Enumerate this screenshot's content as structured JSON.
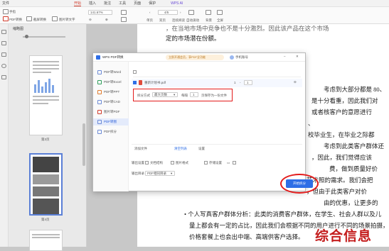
{
  "menubar": {
    "items": [
      "文件",
      "",
      "",
      "",
      "",
      "开始",
      "插入",
      "批注",
      "工具",
      "页面",
      "保护",
      "",
      "WPS AI",
      "",
      ""
    ],
    "active": "开始"
  },
  "toolbar": {
    "left_labels": [
      "手指",
      "PDF转换",
      "截屏转换",
      "图片转文字"
    ],
    "zoom": "141.67%",
    "page": "4/5",
    "view_labels": [
      "单页",
      "双页",
      "连续阅读"
    ],
    "tools": [
      "自动滚动",
      "背景",
      "全屏"
    ]
  },
  "left_panel": {
    "title": "缩略图",
    "thumbs": [
      {
        "label": "第3页"
      },
      {
        "label": "第4页"
      }
    ]
  },
  "document": {
    "lines_top": [
      "，在当地市场中竞争也不是十分激烈。因此该产品在这个市场",
      "定的市场潜在份额。"
    ],
    "lines_right": [
      "考虑到大部分都是 80、",
      "是十分看重，因此我们对",
      "或者核客户的意愿进行",
      "",
      "、",
      "校毕业生，在毕业之际都",
      "考虑到此类客户群体还",
      "，因此，我们觉得应该",
      "费，做到质量好价",
      "艺术照的需求。我们会把",
      "，但由于此类客户对价",
      "由的优惠，让更多的"
    ],
    "bullet": "• 个人写真客户群体分析：此类的消费客户群体，在学生、社会人群以及儿",
    "lines_bottom": [
      "量上都会有一定的占比，因此我们会根据不同的用户进行不同的场景拍摄，",
      "价格套餐上也会出中端、高端供客户选择。"
    ]
  },
  "dialog": {
    "title": "WPS PDF转换",
    "vip_banner": "立即开通会员，享PDF全功能",
    "account": "手机账号",
    "sidebar": [
      "PDF转Word",
      "PDF转Excel",
      "PDF转PPT",
      "PDF转CAD",
      "图片转PDF",
      "PDF转图",
      "PDF拆分"
    ],
    "active_index": 5,
    "file_row": {
      "checked": true,
      "name": "重新计划书.pdf",
      "pages": "1",
      "page_to": "1"
    },
    "split": {
      "label": "拆分方式",
      "mode": "最大页数",
      "per_label": "每隔",
      "per_value": "1",
      "suffix": "页保存为一份文件"
    },
    "actions": {
      "add": "添加文件",
      "clear": "清空列表",
      "settings": "设置"
    },
    "options": {
      "label": "输出设置",
      "opt1": "文档结构",
      "opt2": "图片格式",
      "opt3": "存储设置"
    },
    "output": {
      "label": "输出目录",
      "value": "PDF相同目录"
    },
    "start": "开始拆分"
  },
  "stamp_text": "综合信息"
}
